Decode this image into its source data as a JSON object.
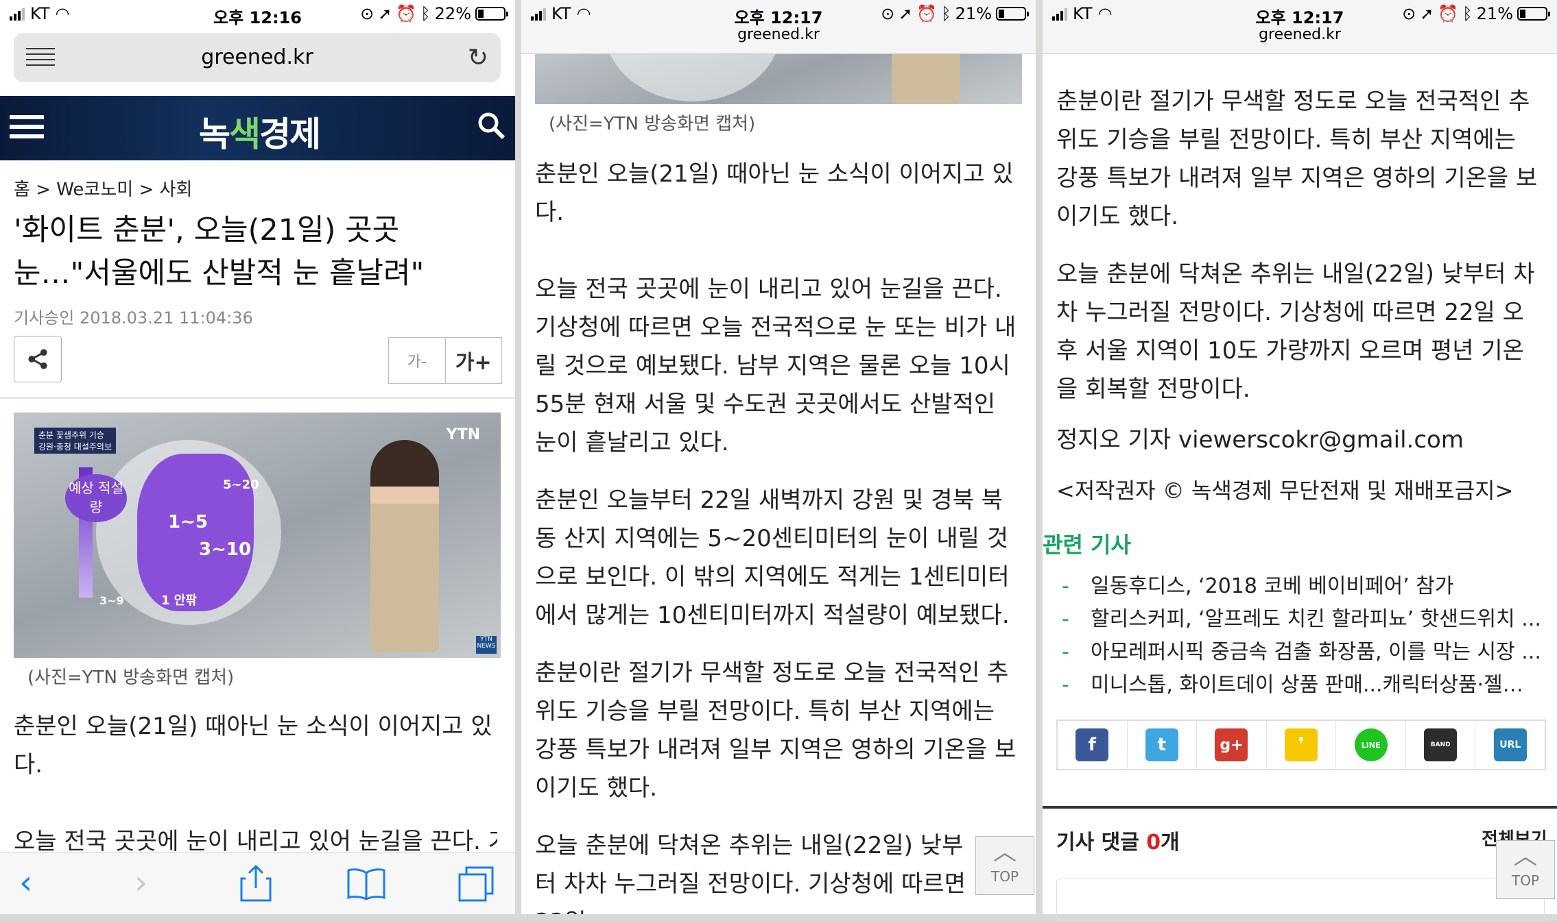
{
  "status": [
    {
      "carrier": "KT",
      "time": "오후 12:16",
      "battery": "22%",
      "battery_level": 0.22
    },
    {
      "carrier": "KT",
      "time": "오후 12:17",
      "battery": "21%",
      "battery_level": 0.21
    },
    {
      "carrier": "KT",
      "time": "오후 12:17",
      "battery": "21%",
      "battery_level": 0.21
    }
  ],
  "browser": {
    "url": "greened.kr",
    "url_small": "greened.kr"
  },
  "site": {
    "logo_a": "녹",
    "logo_b": "색",
    "logo_c": "경제"
  },
  "article": {
    "breadcrumb": "홈 > We코노미 > 사회",
    "title": "'화이트 춘분', 오늘(21일) 곳곳 눈…\"서울에도 산발적 눈 흩날려\"",
    "meta": "기사승인 2018.03.21  11:04:36",
    "font_small": "가-",
    "font_large": "가+",
    "caption": "(사진=YTN 방송화면 캡처)",
    "photo": {
      "tag": "춘분 꽃샘추위 기승",
      "tag2": "강원·충청 대설주의보",
      "pill": "예상 적설량",
      "l1": "1~5",
      "l2": "3~10",
      "l3": "5~20",
      "l4": "1 안팎",
      "l5": "3~9",
      "ytn": "YTN",
      "ytn_small": "YTN NEWS"
    },
    "p1": "춘분인 오늘(21일) 때아닌 눈 소식이 이어지고 있다.",
    "p2": "오늘 전국 곳곳에 눈이 내리고 있어 눈길을 끈다. 기상청에 따르면 오늘 전국적으로 눈 또는 비가 내릴 것으로 예보됐다. 남부 지역은 물론 오늘 10시 55분 현재 서울 및 수도권 곳곳에서도 산발적인 눈이 흩날리고 있다.",
    "p3": "춘분인 오늘부터 22일 새벽까지 강원 및 경북 북동 산지 지역에는 5~20센티미터의 눈이 내릴 것으로 보인다. 이 밖의 지역에도 적게는 1센티미터에서 많게는 10센티미터까지 적설량이 예보됐다.",
    "p4": "춘분이란 절기가 무색할 정도로 오늘 전국적인 추위도 기승을 부릴 전망이다. 특히 부산 지역에는 강풍 특보가 내려져 일부 지역은 영하의 기온을 보이기도 했다.",
    "p5": "오늘 춘분에 닥쳐온 추위는 내일(22일) 낮부터 차차 누그러질 전망이다. 기상청에 따르면 22일 오후 서울 지역이 10도 가량까지 오르며 평년 기온을 회복할 전망이다.",
    "p5_partial": "오늘 춘분에 닥쳐온 추위는 내일(22일) 낮부터 차차 누그러질 전망이다. 기상청에 따르면 22일",
    "reporter": "정지오 기자 viewerscokr@gmail.com",
    "copyright": "<저작권자 © 녹색경제 무단전재 및 재배포금지>"
  },
  "related": {
    "title": "관련 기사",
    "items": [
      "일동후디스, ‘2018 코베 베이비페어’ 참가",
      "할리스커피, ‘알프레도 치킨 할라피뇨’ 핫샌드위치 ...",
      "아모레퍼시픽 중금속 검출 화장품, 이를 막는 시장 ...",
      "미니스톱, 화이트데이 상품 판매...캐릭터상품·젤리 ..."
    ]
  },
  "social": [
    {
      "name": "facebook",
      "glyph": "f",
      "color": "#3b5998"
    },
    {
      "name": "twitter",
      "glyph": "t",
      "color": "#3fa7e0"
    },
    {
      "name": "google-plus",
      "glyph": "g+",
      "color": "#d23b2d"
    },
    {
      "name": "kakaostory",
      "glyph": "❜",
      "color": "#f5c800"
    },
    {
      "name": "line",
      "glyph": "LINE",
      "color": "#1fc41f"
    },
    {
      "name": "band",
      "glyph": "BAND",
      "color": "#2c2c2c"
    },
    {
      "name": "url",
      "glyph": "URL",
      "color": "#2a7fb6"
    }
  ],
  "comments": {
    "title": "기사 댓글 ",
    "count": "0",
    "suffix": "개",
    "all": "전체보기"
  },
  "top_button": "TOP"
}
